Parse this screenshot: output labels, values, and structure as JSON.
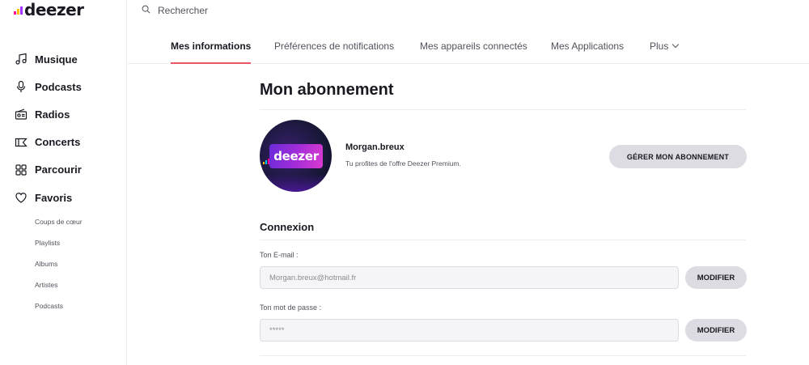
{
  "brand": {
    "name": "deezer",
    "bar_colors": [
      "#ff0092",
      "#ffc000",
      "#a238ff",
      "#00c7f2",
      "#ff5a00"
    ]
  },
  "search": {
    "placeholder": "Rechercher"
  },
  "sidebar": {
    "items": [
      {
        "label": "Musique",
        "icon": "music-note-icon"
      },
      {
        "label": "Podcasts",
        "icon": "microphone-icon"
      },
      {
        "label": "Radios",
        "icon": "radio-icon"
      },
      {
        "label": "Concerts",
        "icon": "ticket-icon"
      },
      {
        "label": "Parcourir",
        "icon": "grid-icon"
      },
      {
        "label": "Favoris",
        "icon": "heart-icon"
      }
    ],
    "sub_items": [
      "Coups de cœur",
      "Playlists",
      "Albums",
      "Artistes",
      "Podcasts"
    ]
  },
  "tabs": [
    {
      "label": "Mes informations",
      "active": true
    },
    {
      "label": "Préférences de notifications",
      "active": false
    },
    {
      "label": "Mes appareils connectés",
      "active": false
    },
    {
      "label": "Mes Applications",
      "active": false
    },
    {
      "label": "Plus",
      "active": false
    }
  ],
  "main": {
    "title": "Mon abonnement",
    "profile": {
      "username": "Morgan.breux",
      "offer": "Tu profites de l'offre Deezer Premium.",
      "avatar_text": "deezer",
      "manage_button": "GÉRER MON ABONNEMENT"
    },
    "connexion": {
      "title": "Connexion",
      "email_label": "Ton E-mail :",
      "email_value": "Morgan.breux@hotmail.fr",
      "password_label": "Ton mot de passe :",
      "password_value": "*****",
      "modify_label": "MODIFIER"
    }
  },
  "colors": {
    "accent": "#ef5466",
    "button_bg": "#dcdce2",
    "text": "#191922",
    "muted": "#52525d"
  }
}
